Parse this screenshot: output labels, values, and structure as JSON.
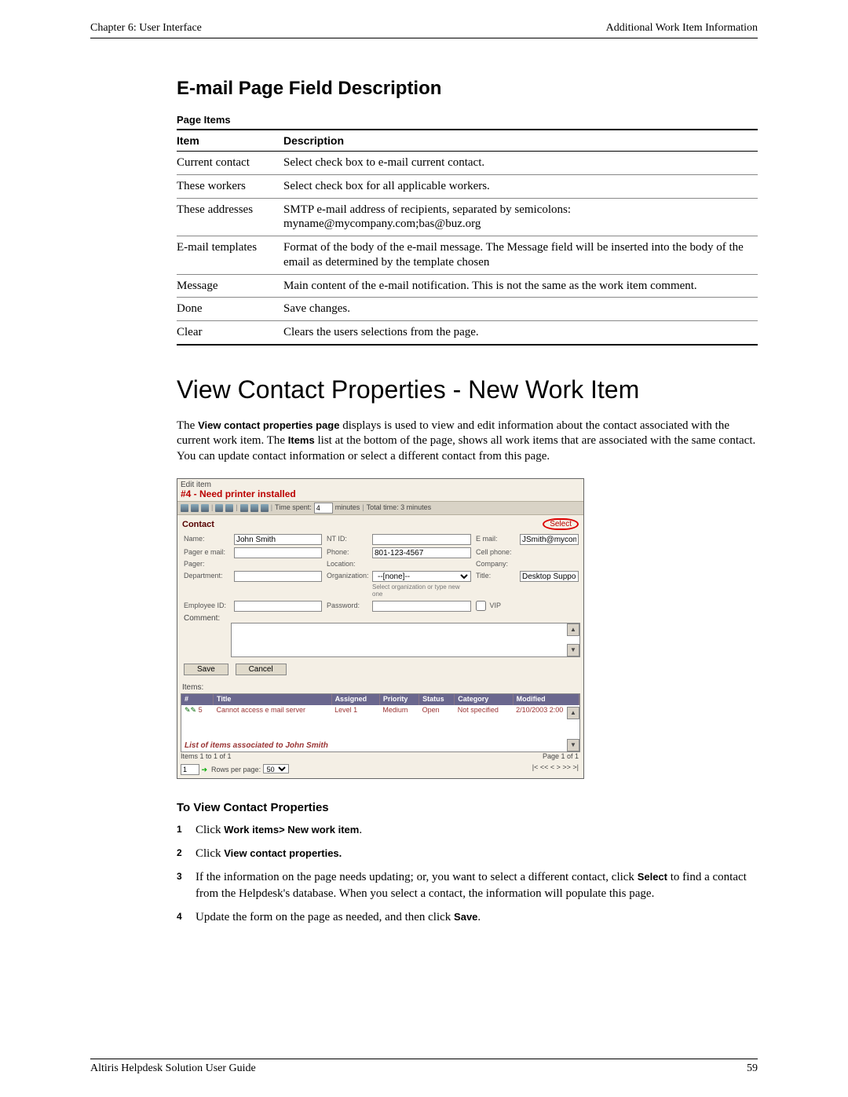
{
  "header": {
    "chapter": "Chapter 6: User Interface",
    "section": "Additional Work Item Information"
  },
  "email_section": {
    "title": "E-mail Page Field Description",
    "caption": "Page Items",
    "col_item": "Item",
    "col_desc": "Description",
    "rows": [
      {
        "item": "Current contact",
        "desc": "Select check box to e-mail current contact."
      },
      {
        "item": "These workers",
        "desc": "Select check box for all applicable workers."
      },
      {
        "item": "These addresses",
        "desc": "SMTP e-mail address of recipients, separated by semicolons: myname@mycompany.com;bas@buz.org"
      },
      {
        "item": "E-mail templates",
        "desc": "Format of the body of the e-mail message. The Message field will be inserted into the body of the email as determined by the template chosen"
      },
      {
        "item": "Message",
        "desc": "Main content of the e-mail notification. This is not the same as the work item comment."
      },
      {
        "item": "Done",
        "desc": "Save changes."
      },
      {
        "item": "Clear",
        "desc": "Clears the users selections from the page."
      }
    ]
  },
  "view_section": {
    "title": "View Contact Properties - New Work Item",
    "intro_pre": "The ",
    "intro_bold1": "View contact properties page",
    "intro_mid": " displays is used to view and edit information about the contact associated with the current work item. The ",
    "intro_bold2": "Items",
    "intro_post": " list at the bottom of the page, shows all work items that are associated with the same contact. You can update contact information or select a different contact from this page."
  },
  "shot": {
    "edit_item": "Edit item",
    "work_title": "#4 - Need printer installed",
    "toolbar": {
      "time_spent_label": "Time spent:",
      "time_spent_val": "4",
      "minutes": "minutes",
      "total": "Total time: 3 minutes"
    },
    "contact_hdr": "Contact",
    "select": "Select",
    "labels": {
      "name": "Name:",
      "ntid": "NT ID:",
      "email": "E mail:",
      "pagermail": "Pager e mail:",
      "phone": "Phone:",
      "cell": "Cell phone:",
      "pager": "Pager:",
      "loc": "Location:",
      "company": "Company:",
      "dept": "Department:",
      "org": "Organization:",
      "title": "Title:",
      "org_note": "Select organization or type new one",
      "emp": "Employee ID:",
      "pwd": "Password:",
      "vip": "VIP",
      "comment": "Comment:"
    },
    "vals": {
      "name": "John Smith",
      "email": "JSmith@mycompany.com",
      "phone": "801-123-4567",
      "org": "--[none]--",
      "title": "Desktop Support"
    },
    "save": "Save",
    "cancel": "Cancel",
    "items_label": "Items:",
    "cols": {
      "num": "#",
      "title": "Title",
      "assigned": "Assigned",
      "priority": "Priority",
      "status": "Status",
      "category": "Category",
      "modified": "Modified"
    },
    "row": {
      "num": "5",
      "title": "Cannot access e mail server",
      "assigned": "Level 1",
      "priority": "Medium",
      "status": "Open",
      "category": "Not specified",
      "modified": "2/10/2003 2:00"
    },
    "assoc": "List of items associated to John Smith",
    "pager": {
      "items": "Items 1 to 1 of 1",
      "page_ix": "1",
      "rows_label": "Rows per page:",
      "rows": "50",
      "page_of": "Page 1 of 1",
      "nav": "|<  <<  <  >  >>  >|"
    }
  },
  "steps_title": "To View Contact Properties",
  "steps": {
    "s1_a": "Click ",
    "s1_b": "Work items> New work item",
    "s2_a": "Click ",
    "s2_b": "View contact properties.",
    "s3_a": "If the information on the page needs updating; or, you want to select a different contact, click ",
    "s3_b": "Select",
    "s3_c": " to find a contact from the Helpdesk's database. When you select a contact, the information will populate this page.",
    "s4_a": "Update the form on the page as needed, and then click ",
    "s4_b": "Save",
    "s4_c": "."
  },
  "footer": {
    "left": "Altiris Helpdesk Solution User Guide",
    "right": "59"
  }
}
